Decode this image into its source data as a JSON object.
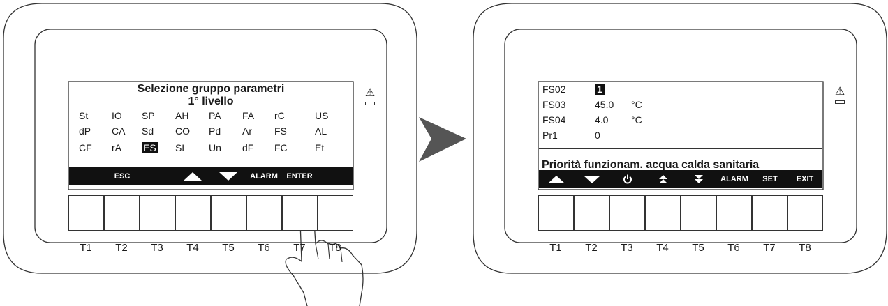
{
  "left_panel": {
    "title_line1": "Selezione gruppo parametri",
    "title_line2": "1° livello",
    "codes": [
      [
        "St",
        "IO",
        "SP",
        "AH",
        "PA",
        "FA",
        "rC",
        "US"
      ],
      [
        "dP",
        "CA",
        "Sd",
        "CO",
        "Pd",
        "Ar",
        "FS",
        "AL"
      ],
      [
        "CF",
        "rA",
        "ES",
        "SL",
        "Un",
        "dF",
        "FC",
        "Et"
      ]
    ],
    "selected_code": "ES",
    "softkeys": [
      "",
      "ESC",
      "",
      "up",
      "down",
      "ALARM",
      "ENTER",
      ""
    ],
    "key_labels": [
      "T1",
      "T2",
      "T3",
      "T4",
      "T5",
      "T6",
      "T7",
      "T8"
    ]
  },
  "right_panel": {
    "params": [
      {
        "code": "FS02",
        "value": "1",
        "unit": "",
        "selected": true
      },
      {
        "code": "FS03",
        "value": "45.0",
        "unit": "°C",
        "selected": false
      },
      {
        "code": "FS04",
        "value": "4.0",
        "unit": "°C",
        "selected": false
      },
      {
        "code": "Pr1",
        "value": "0",
        "unit": "",
        "selected": false
      }
    ],
    "description": "Priorità funzionam. acqua calda sanitaria",
    "softkeys": [
      "up",
      "down",
      "power",
      "page-up",
      "page-down",
      "ALARM",
      "SET",
      "EXIT"
    ],
    "key_labels": [
      "T1",
      "T2",
      "T3",
      "T4",
      "T5",
      "T6",
      "T7",
      "T8"
    ]
  },
  "icons": {
    "warning": "⚠",
    "arrow": "transition-arrow-icon",
    "hand": "pointing-hand-icon"
  },
  "colors": {
    "outline": "#333333",
    "lcd_bar": "#111111",
    "arrow": "#555555"
  }
}
